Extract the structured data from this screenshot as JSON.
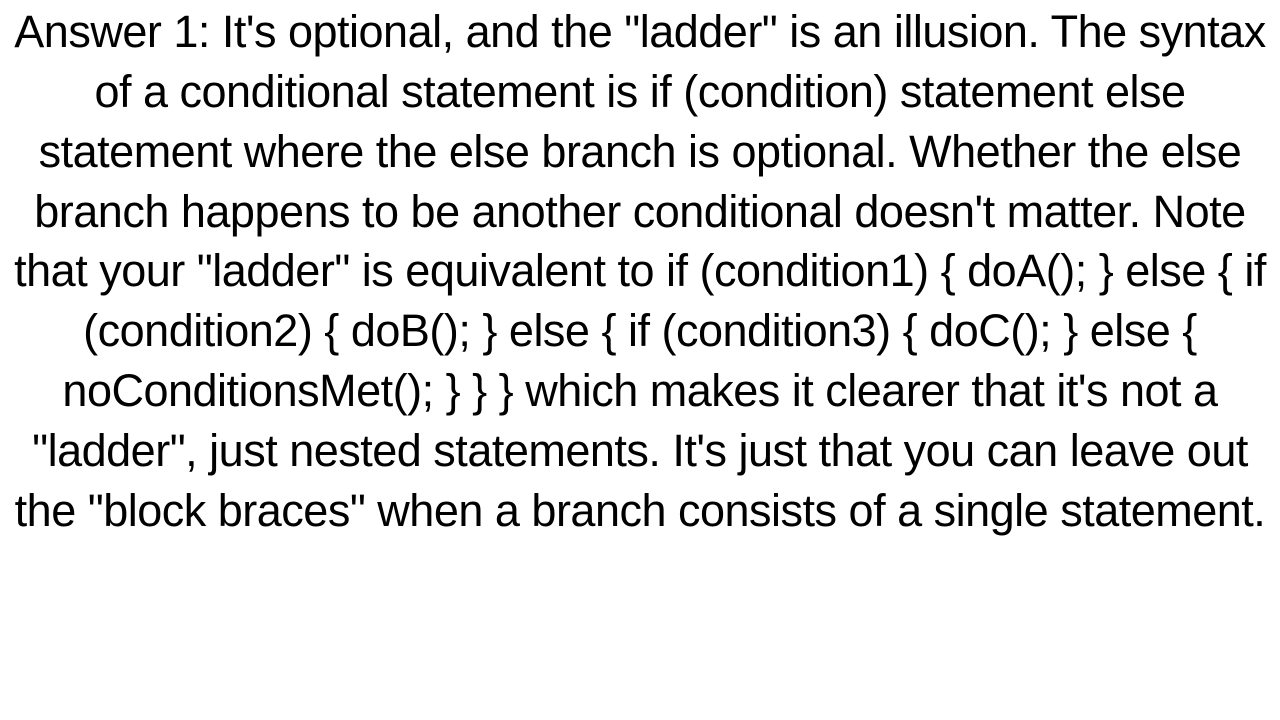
{
  "body_text": "Answer 1: It's optional, and the \"ladder\" is an illusion. The syntax of a conditional statement is if (condition) statement  else      statement  where the else branch is optional. Whether the else branch happens to be another conditional doesn't matter. Note that your \"ladder\" is equivalent to if (condition1) {    doA(); } else {     if (condition2) {       doB();     } else {         if (condition3) {             doC();         } else {             noConditionsMet();         }      } }  which makes it clearer that it's not a \"ladder\", just nested statements. It's just that you can leave out the \"block braces\" when a branch consists of a single statement."
}
